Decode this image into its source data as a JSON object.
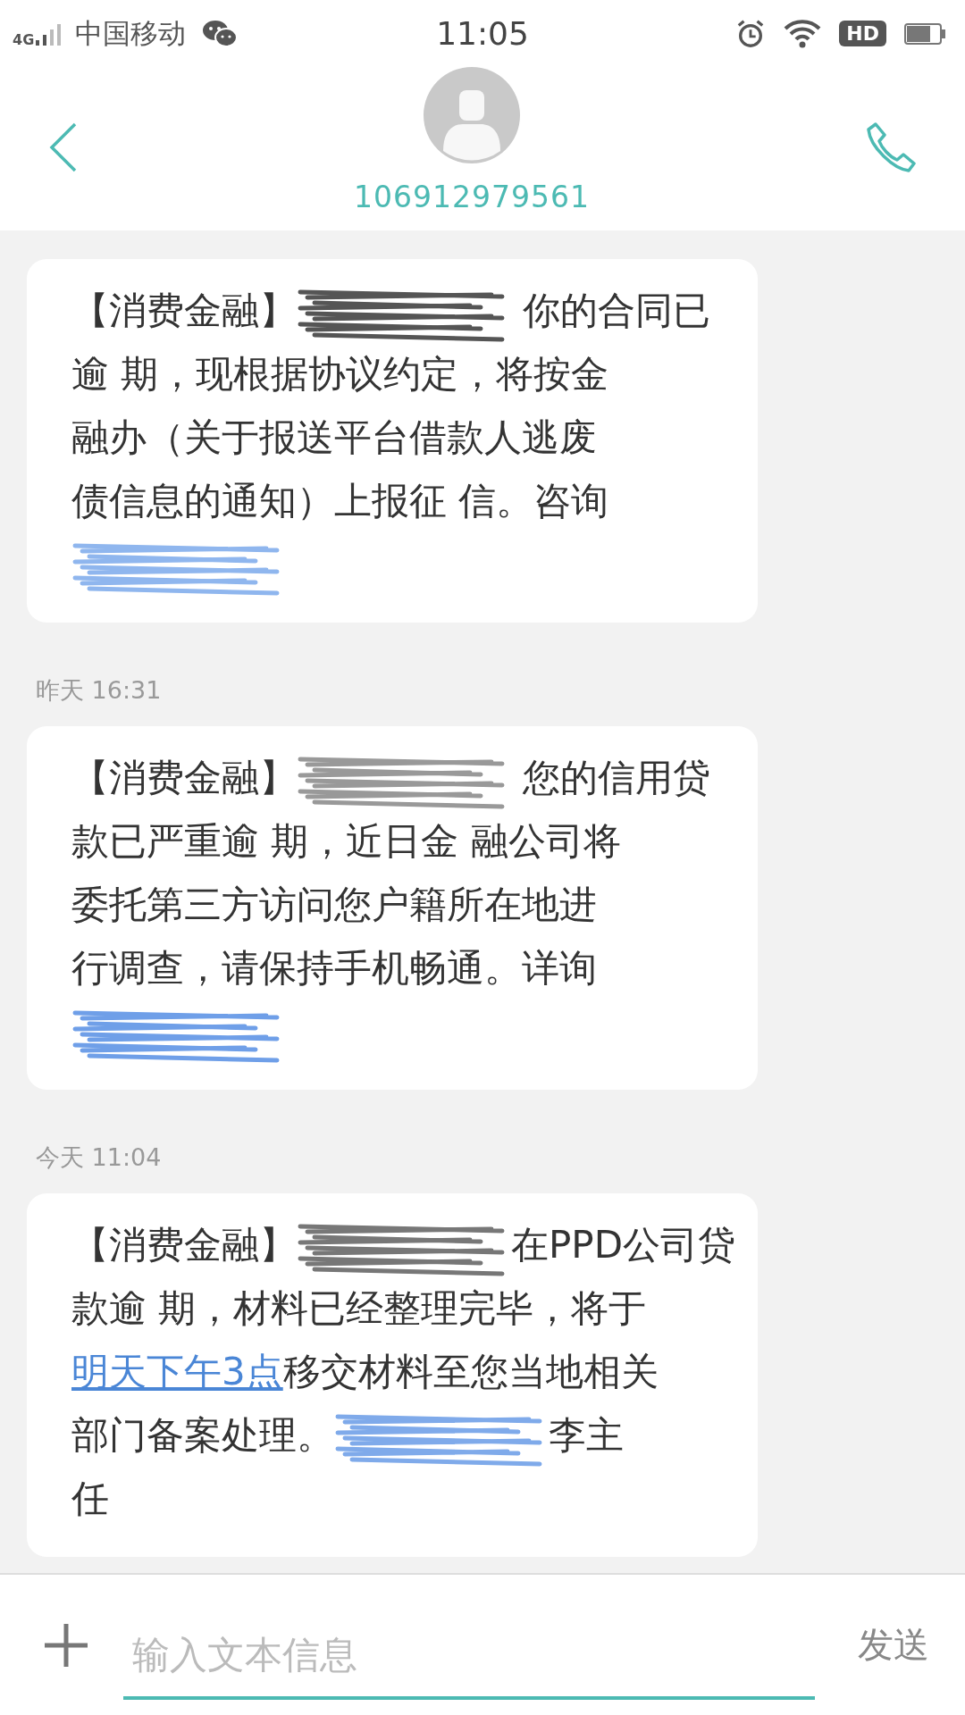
{
  "status_bar": {
    "network": "4G",
    "carrier": "中国移动",
    "time": "11:05",
    "hd": "HD"
  },
  "contact": {
    "number": "106912979561"
  },
  "messages": [
    {
      "segments": [
        {
          "kind": "text",
          "text": "【消费金融】"
        },
        {
          "kind": "redacted",
          "color": "#555555"
        },
        {
          "kind": "text",
          "text": " 你的合同已"
        },
        {
          "kind": "break"
        },
        {
          "kind": "text",
          "text": "逾 期，现根据协议约定，将按金"
        },
        {
          "kind": "break"
        },
        {
          "kind": "text",
          "text": "融办（关于报送平台借款人逃废"
        },
        {
          "kind": "break"
        },
        {
          "kind": "text",
          "text": "债信息的通知）上报征 信。咨询"
        },
        {
          "kind": "break"
        },
        {
          "kind": "redacted",
          "color": "#8fb6ee"
        }
      ]
    },
    {
      "timestamp": "昨天  16:31",
      "segments": [
        {
          "kind": "text",
          "text": "【消费金融】"
        },
        {
          "kind": "redacted",
          "color": "#999999"
        },
        {
          "kind": "text",
          "text": " 您的信用贷"
        },
        {
          "kind": "break"
        },
        {
          "kind": "text",
          "text": "款已严重逾 期，近日金 融公司将"
        },
        {
          "kind": "break"
        },
        {
          "kind": "text",
          "text": "委托第三方访问您户籍所在地进"
        },
        {
          "kind": "break"
        },
        {
          "kind": "text",
          "text": "行调查，请保持手机畅通。详询"
        },
        {
          "kind": "break"
        },
        {
          "kind": "redacted",
          "color": "#6f9fe8"
        }
      ]
    },
    {
      "timestamp": "今天  11:04",
      "segments": [
        {
          "kind": "text",
          "text": "【消费金融】"
        },
        {
          "kind": "redacted",
          "color": "#777777"
        },
        {
          "kind": "text",
          "text": "在PPD公司贷"
        },
        {
          "kind": "break"
        },
        {
          "kind": "text",
          "text": "款逾 期，材料已经整理完毕，将于"
        },
        {
          "kind": "break"
        },
        {
          "kind": "link",
          "text": "明天下午3点"
        },
        {
          "kind": "text",
          "text": "移交材料至您当地相关"
        },
        {
          "kind": "break"
        },
        {
          "kind": "text",
          "text": "部门备案处理。"
        },
        {
          "kind": "redacted",
          "color": "#7faaea"
        },
        {
          "kind": "text",
          "text": "李主"
        },
        {
          "kind": "break"
        },
        {
          "kind": "text",
          "text": "任"
        }
      ]
    }
  ],
  "composer": {
    "placeholder": "输入文本信息",
    "send": "发送"
  }
}
